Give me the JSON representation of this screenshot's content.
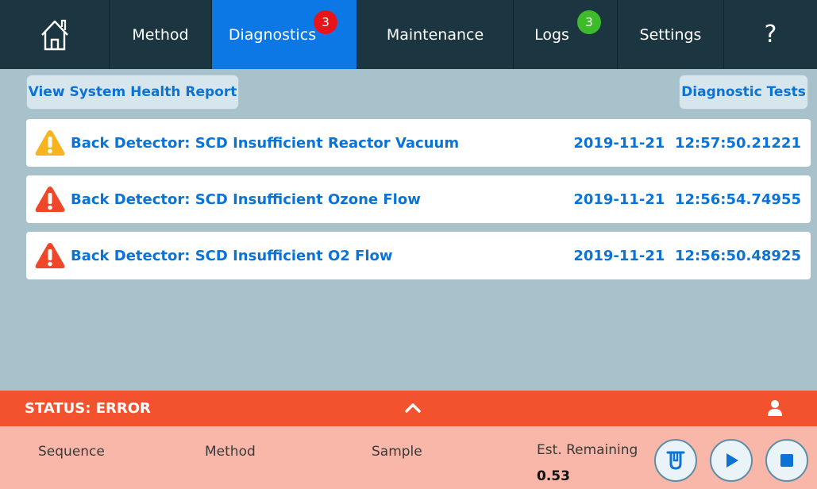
{
  "nav": {
    "method": "Method",
    "diagnostics": "Diagnostics",
    "diagnostics_badge": "3",
    "maintenance": "Maintenance",
    "logs": "Logs",
    "logs_badge": "3",
    "settings": "Settings",
    "help": "?"
  },
  "actions": {
    "view_report": "View System Health Report",
    "diagnostic_tests": "Diagnostic Tests"
  },
  "alerts": [
    {
      "severity": "warning",
      "message": "Back Detector: SCD Insufficient Reactor Vacuum",
      "timestamp": "2019-11-21  12:57:50.21221"
    },
    {
      "severity": "error",
      "message": "Back Detector: SCD Insufficient Ozone Flow",
      "timestamp": "2019-11-21  12:56:54.74955"
    },
    {
      "severity": "error",
      "message": "Back Detector: SCD Insufficient O2 Flow",
      "timestamp": "2019-11-21  12:56:50.48925"
    }
  ],
  "status": {
    "text": "STATUS: ERROR"
  },
  "bottom": {
    "sequence_label": "Sequence",
    "method_label": "Method",
    "sample_label": "Sample",
    "est_remaining_label": "Est. Remaining",
    "est_remaining_value": "0.53"
  },
  "colors": {
    "nav_bg": "#1b3641",
    "active_tab": "#0c78e6",
    "status_error": "#f2522d",
    "link_blue": "#0b73d6",
    "warning": "#f7b41e",
    "error": "#f0462a"
  }
}
